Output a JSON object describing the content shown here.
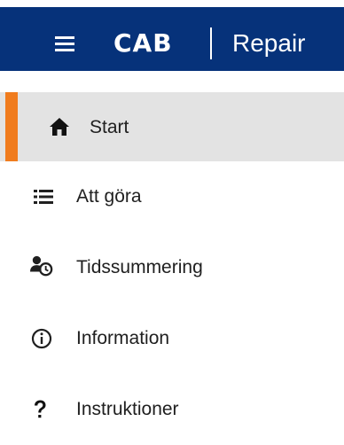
{
  "header": {
    "brand_logo": "CAB",
    "app_name": "Repair",
    "colors": {
      "bar": "#06327a",
      "accent": "#f07c1e"
    }
  },
  "nav": {
    "items": [
      {
        "label": "Start",
        "icon": "home-icon",
        "active": true
      },
      {
        "label": "Att göra",
        "icon": "checklist-icon",
        "active": false
      },
      {
        "label": "Tidssummering",
        "icon": "user-clock-icon",
        "active": false
      },
      {
        "label": "Information",
        "icon": "info-icon",
        "active": false
      },
      {
        "label": "Instruktioner",
        "icon": "question-icon",
        "active": false
      }
    ]
  }
}
